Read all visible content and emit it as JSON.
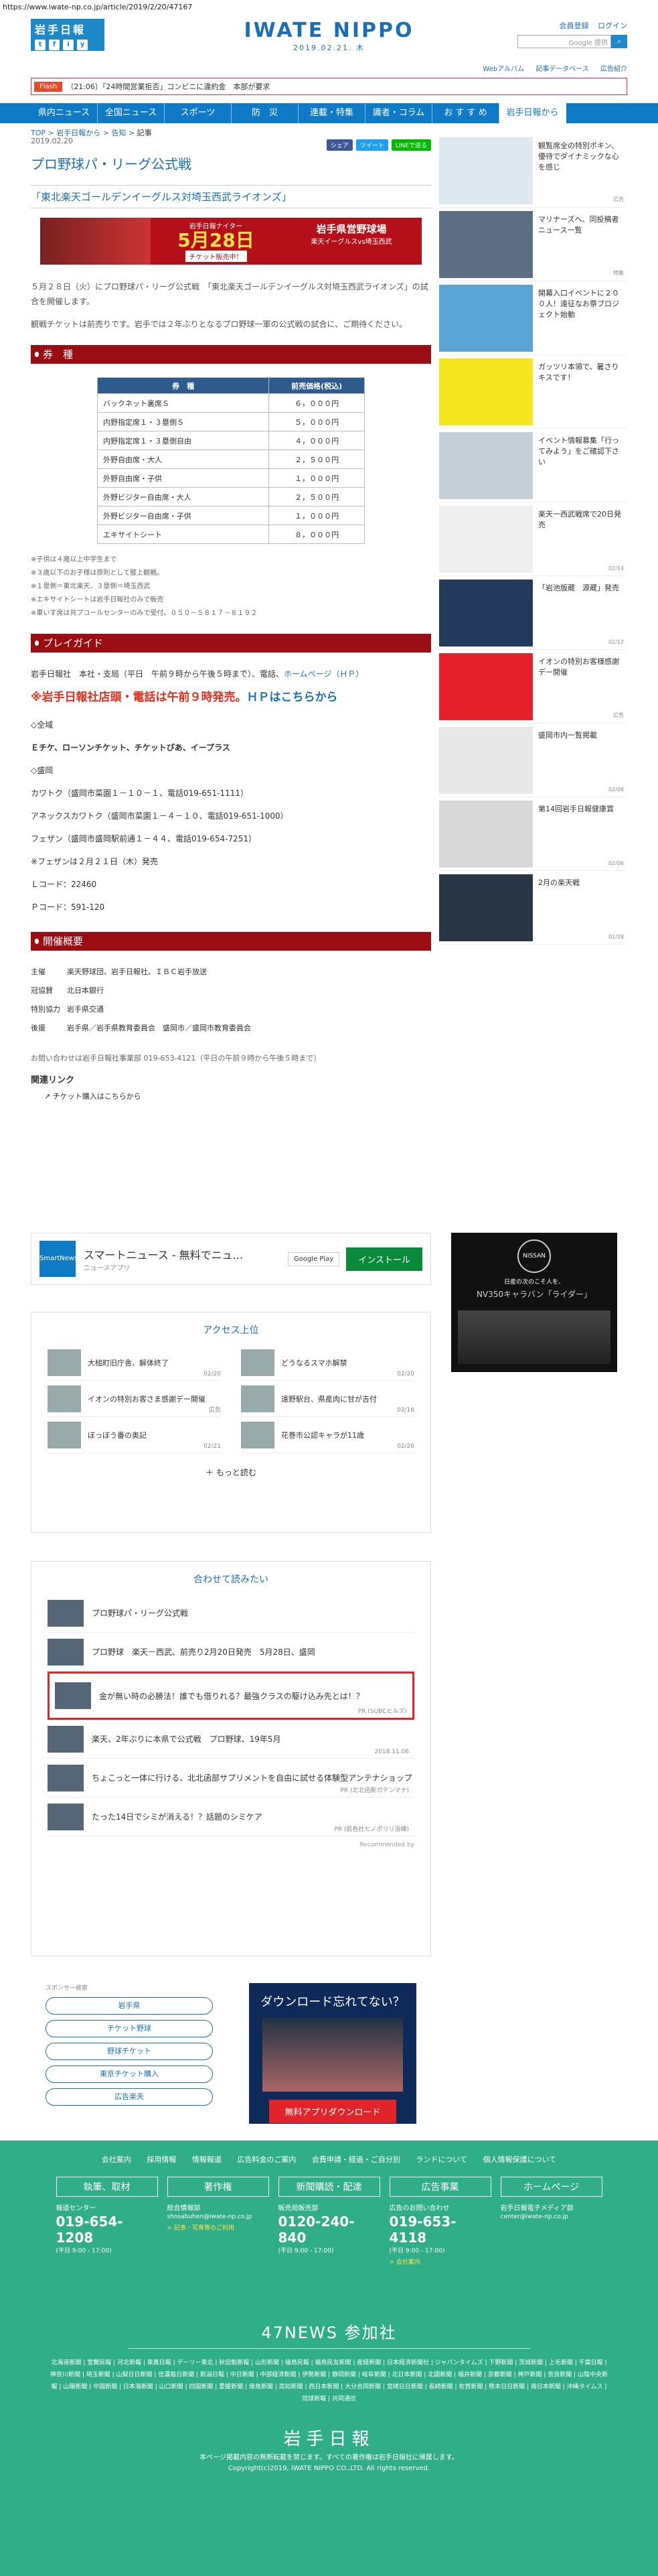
{
  "url": "https://www.iwate-np.co.jp/article/2019/2/20/47167",
  "header": {
    "left_logo": "岩手日報",
    "social": [
      "t",
      "f",
      "i",
      "y"
    ],
    "title": "IWATE NIPPO",
    "date": "2019.02.21. 木",
    "links": [
      "会員登録",
      "ログイン"
    ],
    "search_placeholder": "Google 提供",
    "subnav": [
      "Webアルバム",
      "記事データベース",
      "広告紹介"
    ]
  },
  "ticker": {
    "label": "Flash",
    "text": "（21:06）「24時間営業拒否」コンビニに違約金　本部が要求"
  },
  "nav": [
    "県内ニュース",
    "全国ニュース",
    "スポーツ",
    "防　災",
    "連載・特集",
    "識者・コラム",
    "お す す め",
    "岩手日報から"
  ],
  "breadcrumb": [
    "TOP",
    "岩手日報から",
    "告知",
    "記事"
  ],
  "article": {
    "date": "2019.02.20",
    "share": [
      "シェア",
      "ツイート",
      "LINEで送る"
    ],
    "title": "プロ野球パ・リーグ公式戦",
    "subtitle": "「東北楽天ゴールデンイーグルス対埼玉西武ライオンズ」",
    "banner": {
      "t1": "岩手日報ナイター",
      "t2": "5月28日",
      "t3": "チケット販売中！",
      "s1": "岩手県営野球場",
      "s2": "楽天イーグルスvs埼玉西武"
    },
    "para1": "５月２８日（火）にプロ野球パ・リーグ公式戦　「東北楽天ゴールデンイーグルス対埼玉西武ライオンズ」の試合を開催します。",
    "para2": "観戦チケットは前売りです。岩手では２年ぶりとなるプロ野球一軍の公式戦の試合に、ご期待ください。",
    "sec_ticket": "券　種",
    "table": {
      "headers": [
        "券　種",
        "前売価格(税込)"
      ],
      "rows": [
        [
          "バックネット裏席Ｓ",
          "６，０００円"
        ],
        [
          "内野指定席１・３塁側Ｓ",
          "５，０００円"
        ],
        [
          "内野指定席１・３塁側自由",
          "４，０００円"
        ],
        [
          "外野自由席・大人",
          "２，５００円"
        ],
        [
          "外野自由席・子供",
          "１，０００円"
        ],
        [
          "外野ビジター自由席・大人",
          "２，５００円"
        ],
        [
          "外野ビジター自由席・子供",
          "１，０００円"
        ],
        [
          "エキサイトシート",
          "８，０００円"
        ]
      ]
    },
    "notes": [
      "※子供は４歳以上中学生まで",
      "※３歳以下のお子様は原則として膝上観戦。",
      "※１塁側＝東北楽天、３塁側＝埼玉西武",
      "※エキサイトシートは岩手日報社のみで販売",
      "※車いす席は共プコールセンターのみで受付。０５０－５８１７－８１９２"
    ],
    "sec_guide": "プレイガイド",
    "guide_text": "岩手日報社　本社・支局（平日　午前９時から午後５時まで）、電話、",
    "guide_link": "ホームページ（ＨＰ）",
    "red_line": "※岩手日報社店頭・電話は午前９時発売。",
    "red_hp": "ＨＰはこちらから",
    "sales": [
      "◇全域",
      "Ｅチケ、ローソンチケット、チケットぴあ、イープラス",
      "◇盛岡",
      "カワトク（盛岡市菜園１－１０－１、電話019-651-1111）",
      "アネックスカワトク（盛岡市菜園１－４－１０、電話019-651-1000）",
      "フェザン（盛岡市盛岡駅前通１－４４、電話019-654-7251）",
      "※フェザンは２月２１日（木）発売",
      "Ｌコード：22460",
      "Ｐコード：591-120"
    ],
    "sec_info": "開催概要",
    "info": [
      {
        "k": "主催",
        "v": "楽天野球団、岩手日報社、ＩＢＣ岩手放送"
      },
      {
        "k": "冠協賛",
        "v": "北日本銀行"
      },
      {
        "k": "特別協力",
        "v": "岩手県交通"
      },
      {
        "k": "後援",
        "v": "岩手県／岩手県教育委員会　盛岡市／盛岡市教育委員会"
      }
    ],
    "contact": "お問い合わせは岩手日報社事業部 019-653-4121（平日の午前９時から午後５時まで）",
    "related": "関連リンク",
    "related_link": "チケット購入はこちらから"
  },
  "sidebar": [
    {
      "text": "観覧席全の特別ボキン、優待でダイナミックな心を感じ",
      "date": "広告",
      "color": "#dfe7ef"
    },
    {
      "text": "マリナーズへ、同投稿者ニュース一覧",
      "date": "特集",
      "color": "#5d6e84"
    },
    {
      "text": "開幕入口イベントに２００人！遠征なお祭プロジェクト始動",
      "date": "",
      "color": "#5aa4d6"
    },
    {
      "text": "ガッツリ本領で、暑さりキスです！",
      "date": "",
      "color": "#f3e61e"
    },
    {
      "text": "イベント情報募集「行ってみよう」をご確認下さい",
      "date": "",
      "color": "#c4cfd8"
    },
    {
      "text": "楽天一西武戦席で20日発売",
      "date": "02/14",
      "color": "#eee"
    },
    {
      "text": "「岩池版蔵　源蔵」発売",
      "date": "02/12",
      "color": "#233a5c"
    },
    {
      "text": "イオンの特別お客様感謝デー開催",
      "date": "広告",
      "color": "#e5202a"
    },
    {
      "text": "盛岡市内一覧掲載",
      "date": "02/08",
      "color": "#e8e8e8"
    },
    {
      "text": "第14回岩手日報健康賞",
      "date": "02/06",
      "color": "#d8d8d8"
    },
    {
      "text": "2月の楽天戦",
      "date": "01/28",
      "color": "#283645"
    }
  ],
  "ad_app": {
    "logo": "SmartNews",
    "title": "スマートニュース - 無料でニュ...",
    "sub": "ニュースアプリ",
    "gp": "Google Play",
    "btn": "インストール"
  },
  "nissan": {
    "brand": "NISSAN",
    "line1": "日産の次のこそ人を、",
    "line2": "NV350キャラバン「ライダー」"
  },
  "access": {
    "title": "アクセス上位",
    "items": [
      {
        "t": "大槌町旧庁舎、解体終了",
        "d": "02/20"
      },
      {
        "t": "どうなるスマホ解禁",
        "d": "02/20"
      },
      {
        "t": "イオンの特別お客さま感謝デー開催",
        "d": "広告"
      },
      {
        "t": "遠野駅台、県産肉に甘が吉付",
        "d": "02/16"
      },
      {
        "t": "ぼっぼう番の奥記",
        "d": "02/21"
      },
      {
        "t": "花巻市公認キャラが11歳",
        "d": "02/20"
      }
    ],
    "more": "もっと読む"
  },
  "awase": {
    "title": "合わせて読みたい",
    "items": [
      {
        "t": "プロ野球パ・リーグ公式戦",
        "d": ""
      },
      {
        "t": "プロ野球　楽天－西武、前売り2月20日発売　5月28日、盛岡",
        "d": ""
      },
      {
        "t": "金が無い時の必勝法！誰でも借りれる？最強クラスの駆け込み先とは！？",
        "d": "PR (SUBCヒルズ)"
      },
      {
        "t": "楽天、2年ぶりに本県で公式戦　プロ野球、19年5月",
        "d": "2018.11.06"
      },
      {
        "t": "ちょこっと一体に行ける、北北函部サプリメントを自由に試せる体験型アンテナショップ",
        "d": "PR (北北函新ガテンマナ)"
      },
      {
        "t": "たった14日でシミが消える！？話題のシミケア",
        "d": "PR (肌色社ヒノポリリ浴練)"
      }
    ],
    "powered": "Recommended by"
  },
  "pills": {
    "label": "スポンサー検索",
    "items": [
      "岩手県",
      "チケット野球",
      "野球チケット",
      "東京チケット購入",
      "広告楽天"
    ]
  },
  "dlad": {
    "title": "ダウンロード忘れてない？",
    "btn": "無料アプリダウンロード"
  },
  "footer": {
    "links": [
      "会社案内",
      "採用情報",
      "情報報道",
      "広告料金のご案内",
      "会費申請・経過・ご自分別",
      "ランドについて",
      "個人情報保護について"
    ],
    "cols": [
      {
        "hd": "執筆、取材",
        "s": "報道センター",
        "tel": "019-654-1208",
        "sm": "(平日 9:00 - 17:00)",
        "link": ""
      },
      {
        "hd": "著作権",
        "s": "総合情報部",
        "tel": "",
        "sm": "shosabuhen@iwate-np.co.jp",
        "link": "> 記事・写真等のご利用"
      },
      {
        "hd": "新聞購読・配達",
        "s": "販売局販売部",
        "tel": "0120-240-840",
        "sm": "(平日 9:00 - 17:00)",
        "link": ""
      },
      {
        "hd": "広告事業",
        "s": "広告のお問い合わせ",
        "tel": "019-653-4118",
        "sm": "(平日 9:00 - 17:00)",
        "link": "> 会社案内"
      },
      {
        "hd": "ホームページ",
        "s": "岩手日報電子メディア部",
        "tel": "",
        "sm": "center@iwate-np.co.jp",
        "link": ""
      }
    ],
    "n47": "47NEWS 参加社",
    "papers": "北海道新聞 | 室蘭民報 | 河北新報 | 東奥日報 | デーリー東北 | 秋田魁新報 | 山形新聞 | 福島民報 | 福島民友新聞 | 産経新聞 | 日本経済新聞社 | ジャパンタイムズ | 下野新聞 | 茨城新聞 | 上毛新聞 | 千葉日報 | 神奈川新聞 | 埼玉新聞 | 山梨日日新聞 | 信濃毎日新聞 | 新潟日報 | 中日新聞 | 中部経済新聞 | 伊勢新聞 | 静岡新聞 | 岐阜新聞 | 北日本新聞 | 北國新聞 | 福井新聞 | 京都新聞 | 神戸新聞 | 奈良新聞 | 山陰中央新報 | 山陽新聞 | 中国新聞 | 日本海新聞 | 山口新聞 | 四国新聞 | 愛媛新聞 | 徳島新聞 | 高知新聞 | 西日本新聞 | 大分合同新聞 | 宮崎日日新聞 | 長崎新聞 | 佐賀新聞 | 熊本日日新聞 | 南日本新聞 | 沖縄タイムス | 琉球新報 | 共同通信",
    "logo": "岩手日報",
    "copy1": "本ページ掲載内容の無断転載を禁じます。すべての著作権は岩手日報社に帰属します。",
    "copy2": "Copyright(c)2019, IWATE NIPPO CO.,LTD. All rights reserved."
  }
}
